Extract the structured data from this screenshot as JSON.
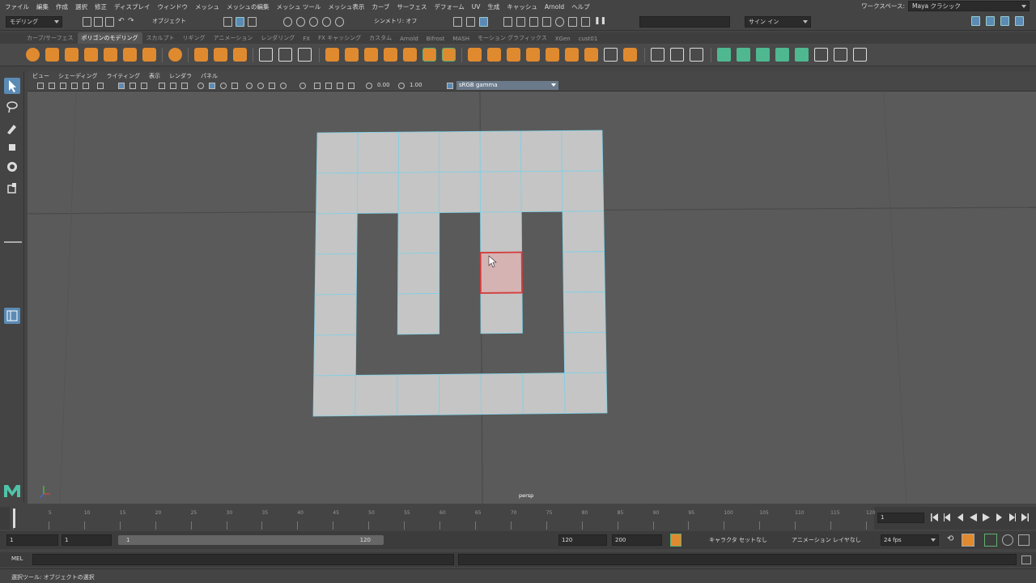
{
  "menubar": {
    "items": [
      "ファイル",
      "編集",
      "作成",
      "選択",
      "修正",
      "ディスプレイ",
      "ウィンドウ",
      "メッシュ",
      "メッシュの編集",
      "メッシュ ツール",
      "メッシュ表示",
      "カーブ",
      "サーフェス",
      "デフォーム",
      "UV",
      "生成",
      "キャッシュ",
      "Arnold",
      "ヘルプ"
    ],
    "workspace_label": "ワークスペース:",
    "workspace_value": "Maya クラシック"
  },
  "statusline": {
    "menuset": "モデリング",
    "object_mode": "オブジェクト",
    "symmetry": "シンメトリ: オフ",
    "signin": "サイン イン"
  },
  "shelf": {
    "tabs": [
      "カーブ/サーフェス",
      "ポリゴンのモデリング",
      "スカルプト",
      "リギング",
      "アニメーション",
      "レンダリング",
      "FX",
      "FX キャッシング",
      "カスタム",
      "Arnold",
      "Bifrost",
      "MASH",
      "モーション グラフィックス",
      "XGen",
      "cust01"
    ],
    "active_tab": 1
  },
  "viewport": {
    "menu": [
      "ビュー",
      "シェーディング",
      "ライティング",
      "表示",
      "レンダラ",
      "パネル"
    ],
    "exposure": "0.00",
    "gamma": "1.00",
    "colorspace": "sRGB gamma",
    "camera_label": "persp",
    "mesh_color": "#c5c5c5",
    "wire_color": "#7fd0e6",
    "selected_face_color": "#d23c3c"
  },
  "timeslider": {
    "ticks": [
      "1",
      "5",
      "10",
      "15",
      "20",
      "25",
      "30",
      "35",
      "40",
      "45",
      "50",
      "55",
      "60",
      "65",
      "70",
      "75",
      "80",
      "85",
      "90",
      "95",
      "100",
      "105",
      "110",
      "115",
      "120"
    ],
    "current_frame": "1"
  },
  "range": {
    "start": "1",
    "playback_start": "1",
    "slider_start": "1",
    "slider_end": "120",
    "playback_end": "120",
    "end": "200",
    "character_set": "キャラクタ セットなし",
    "anim_layer": "アニメーション レイヤなし",
    "fps": "24 fps"
  },
  "cmdline": {
    "label": "MEL"
  },
  "helpline": {
    "text": "選択ツール: オブジェクトの選択"
  }
}
